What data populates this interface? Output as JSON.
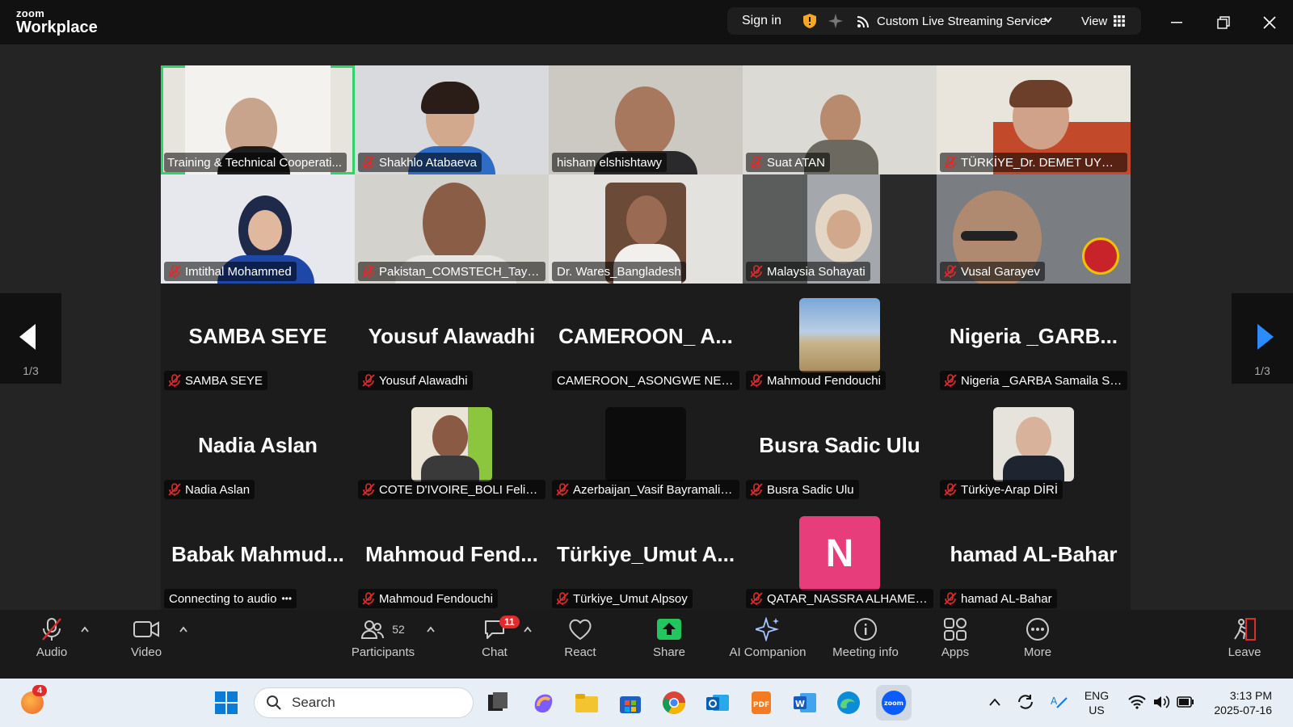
{
  "app": {
    "logo_top": "zoom",
    "logo_bottom": "Workplace"
  },
  "titlebar": {
    "sign_in": "Sign in",
    "streaming": "Custom Live Streaming Service",
    "view": "View"
  },
  "gallery": {
    "page_left": "1/3",
    "page_right": "1/3",
    "tiles": [
      {
        "name": "Training & Technical Cooperati...",
        "big": ""
      },
      {
        "name": "Shakhlo Atabaeva",
        "big": ""
      },
      {
        "name": "hisham elshishtawy",
        "big": ""
      },
      {
        "name": "Suat ATAN",
        "big": ""
      },
      {
        "name": "TÜRKİYE_Dr. DEMET UYGAN",
        "big": ""
      },
      {
        "name": "Imtithal Mohammed",
        "big": ""
      },
      {
        "name": "Pakistan_COMSTECH_Tayyab",
        "big": ""
      },
      {
        "name": "Dr. Wares_Bangladesh",
        "big": ""
      },
      {
        "name": "Malaysia Sohayati",
        "big": ""
      },
      {
        "name": "Vusal Garayev",
        "big": ""
      },
      {
        "name": "SAMBA SEYE",
        "big": "SAMBA SEYE"
      },
      {
        "name": "Yousuf Alawadhi",
        "big": "Yousuf Alawadhi"
      },
      {
        "name": "CAMEROON_ ASONGWE NEFO...",
        "big": "CAMEROON_ A..."
      },
      {
        "name": "Mahmoud Fendouchi",
        "big": ""
      },
      {
        "name": "Nigeria _GARBA Samaila Shi...",
        "big": "Nigeria _GARB..."
      },
      {
        "name": "Nadia Aslan",
        "big": "Nadia Aslan"
      },
      {
        "name": "COTE D'IVOIRE_BOLI Felix J.Z.",
        "big": ""
      },
      {
        "name": "Azerbaijan_Vasif Bayramaliy...",
        "big": ""
      },
      {
        "name": "Busra Sadic Ulu",
        "big": "Busra Sadic Ulu"
      },
      {
        "name": "Türkiye-Arap DİRİ",
        "big": ""
      },
      {
        "name": "Connecting to audio",
        "big": "Babak Mahmud..."
      },
      {
        "name": "Mahmoud Fendouchi",
        "big": "Mahmoud Fend..."
      },
      {
        "name": "Türkiye_Umut Alpsoy",
        "big": "Türkiye_Umut A..."
      },
      {
        "name": "QATAR_NASSRA ALHAMEEDI",
        "big": "",
        "avatar_letter": "N"
      },
      {
        "name": "hamad AL-Bahar",
        "big": "hamad AL-Bahar"
      }
    ]
  },
  "toolbar": {
    "audio": "Audio",
    "video": "Video",
    "participants": "Participants",
    "participants_count": "52",
    "chat": "Chat",
    "chat_badge": "11",
    "react": "React",
    "share": "Share",
    "ai_companion": "AI Companion",
    "meeting_info": "Meeting info",
    "apps": "Apps",
    "more": "More",
    "leave": "Leave"
  },
  "taskbar": {
    "notif_badge": "4",
    "search_placeholder": "Search",
    "lang_top": "ENG",
    "lang_bottom": "US",
    "time": "3:13 PM",
    "date": "2025-07-16"
  },
  "colors": {
    "active_speaker": "#2fd46b",
    "mute_red": "#e02b2b",
    "avatar_pink": "#e83d7b",
    "share_green": "#22c55e"
  }
}
